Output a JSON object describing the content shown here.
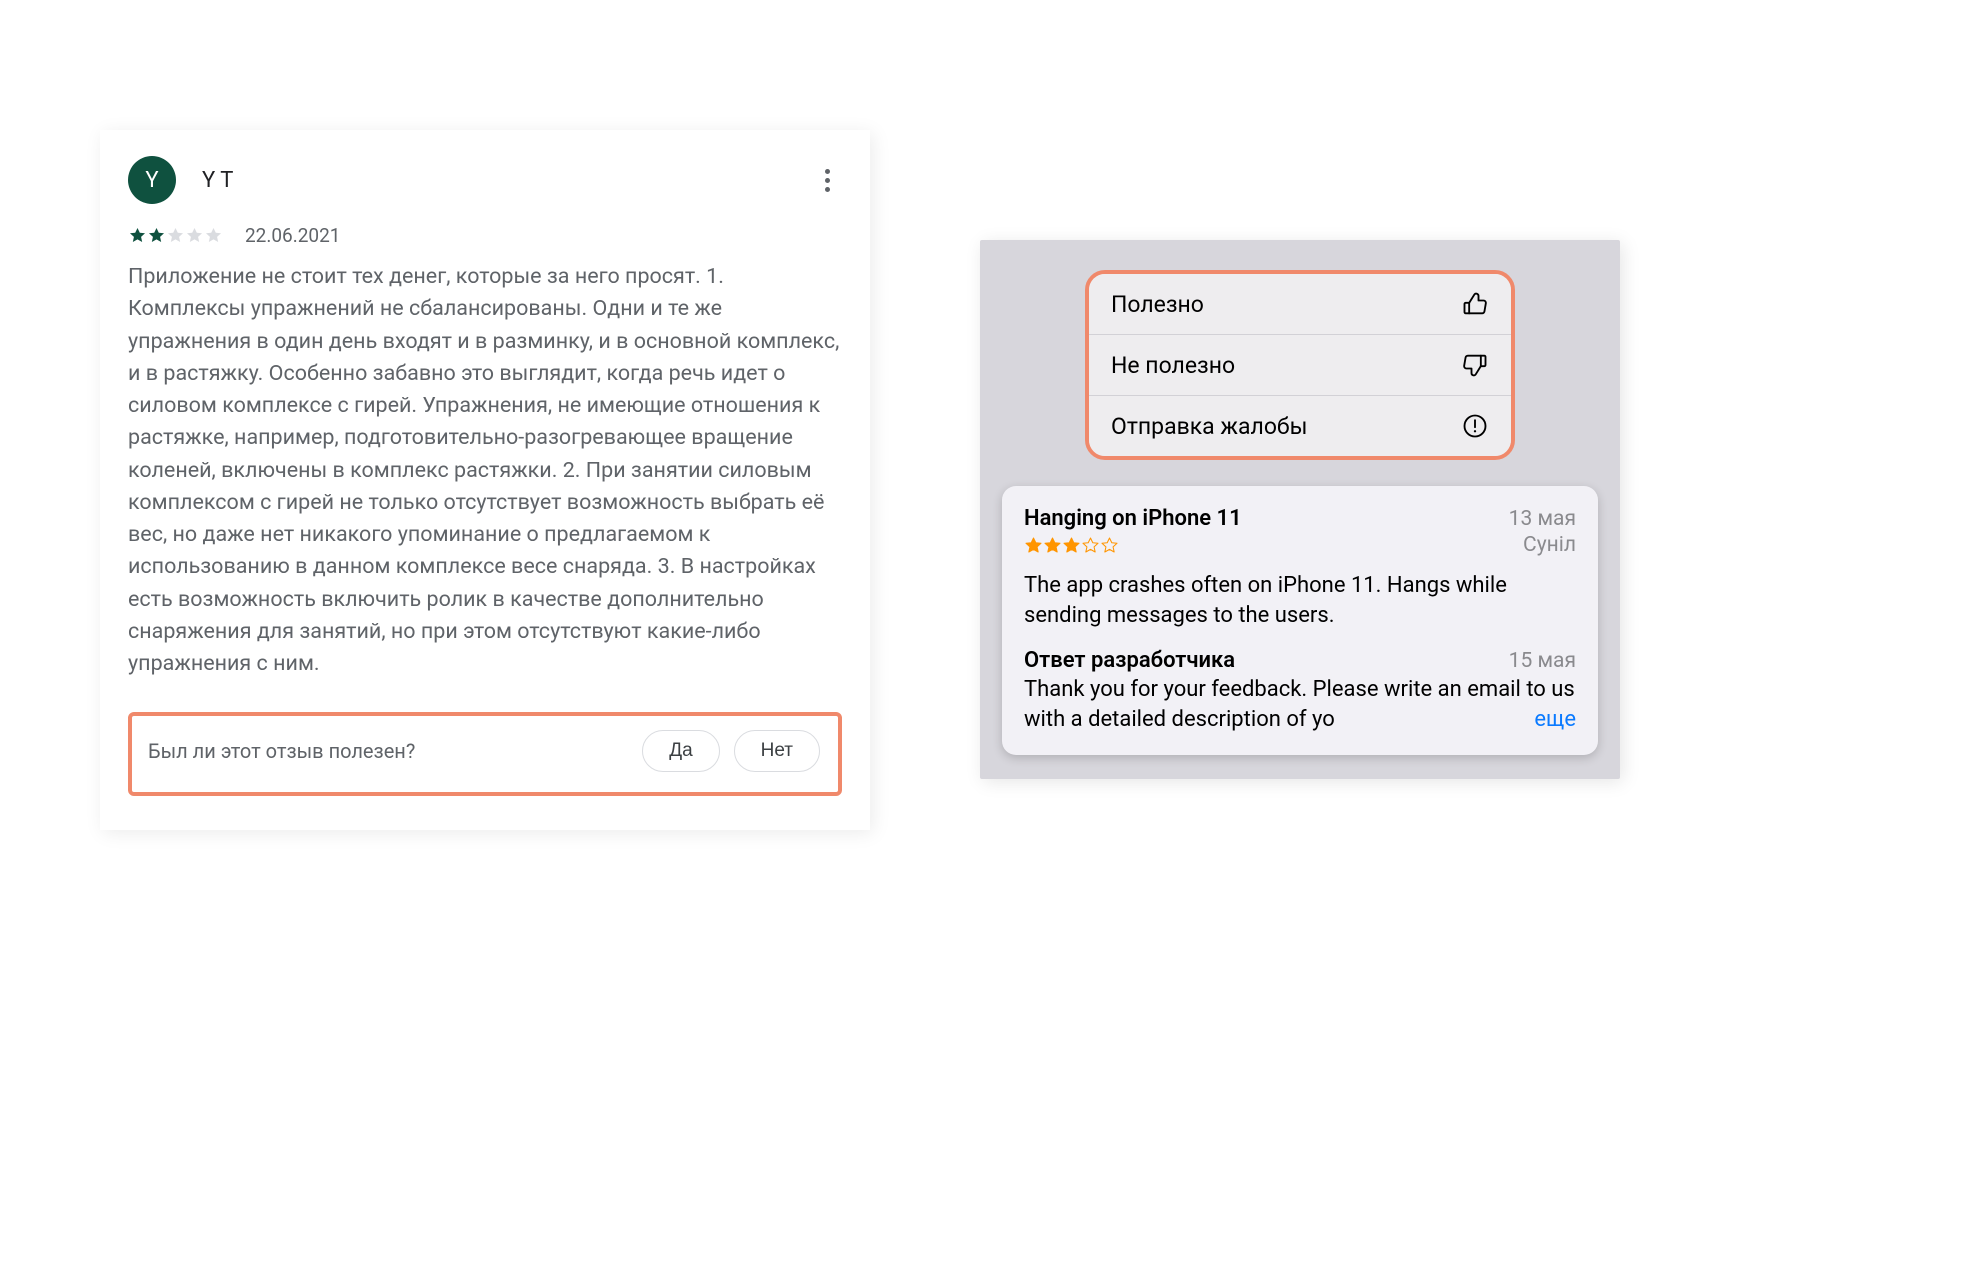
{
  "googlePlay": {
    "avatar_initial": "Y",
    "username": "Y T",
    "rating": 2,
    "max_rating": 5,
    "star_fill": "#0f513f",
    "star_empty": "#dadce0",
    "date": "22.06.2021",
    "body": "Приложение не стоит тех денег, которые за него просят. 1. Комплексы упражнений не сбалансированы. Одни и те же упражнения в один день входят и в разминку, и в основной комплекс, и в растяжку. Особенно забавно это выглядит, когда речь идет о силовом комплексе с гирей. Упражнения, не имеющие отношения к растяжке, например, подготовительно-разогревающее вращение коленей, включены в комплекс растяжки. 2. При занятии силовым комплексом с гирей не только отсутствует возможность выбрать её вес, но даже нет никакого упоминание о предлагаемом к использованию в данном комплексе весе снаряда. 3. В настройках есть возможность включить ролик в качестве дополнительно снаряжения для занятий, но при этом отсутствуют какие-либо упражнения с ним.",
    "useful_question": "Был ли этот отзыв полезен?",
    "yes": "Да",
    "no": "Нет"
  },
  "ios": {
    "menu": {
      "helpful": "Полезно",
      "not_helpful": "Не полезно",
      "report": "Отправка жалобы"
    },
    "review": {
      "title": "Hanging on iPhone 11",
      "date": "13 мая",
      "rating": 3,
      "max_rating": 5,
      "star_fill": "#ff9500",
      "star_empty": "#ff9500",
      "author": "Суніл",
      "body": "The app crashes often on iPhone 11. Hangs while sending messages to the users.",
      "dev_title": "Ответ разработчика",
      "dev_date": "15 мая",
      "dev_body": "Thank you for your feedback. Please write an email to us with a detailed description of  yo",
      "more": "еще"
    }
  }
}
